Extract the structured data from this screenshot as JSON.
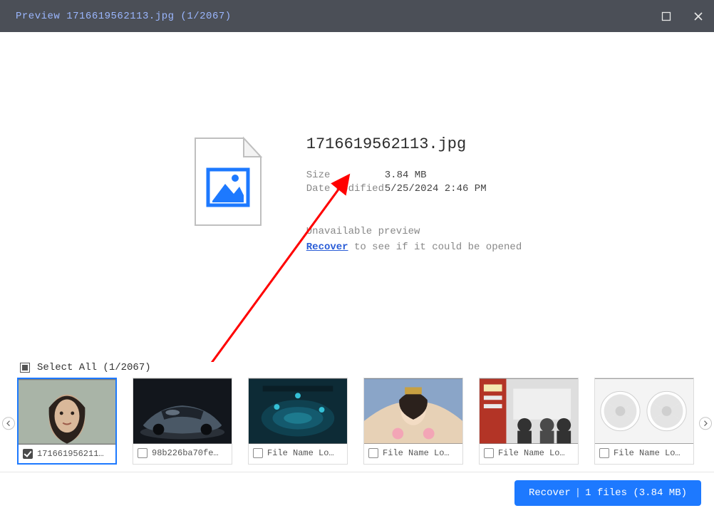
{
  "titlebar": {
    "title": "Preview 1716619562113.jpg (1/2067)"
  },
  "preview": {
    "filename": "1716619562113.jpg",
    "size_label": "Size",
    "size_value": "3.84 MB",
    "modified_label": "Date Modified",
    "modified_value": "5/25/2024 2:46 PM",
    "unavailable": "Unavailable preview",
    "recover_link": "Recover",
    "recover_suffix": " to see if it could be opened"
  },
  "strip_header": {
    "select_all": "Select All (1/2067)"
  },
  "thumbnails": [
    {
      "label": "171661956211…",
      "checked": true,
      "selected": true,
      "variant": "portrait"
    },
    {
      "label": "98b226ba70fe…",
      "checked": false,
      "selected": false,
      "variant": "car"
    },
    {
      "label": "File Name Lo…",
      "checked": false,
      "selected": false,
      "variant": "game"
    },
    {
      "label": "File Name Lo…",
      "checked": false,
      "selected": false,
      "variant": "costume"
    },
    {
      "label": "File Name Lo…",
      "checked": false,
      "selected": false,
      "variant": "meeting"
    },
    {
      "label": "File Name Lo…",
      "checked": false,
      "selected": false,
      "variant": "fans"
    }
  ],
  "footer": {
    "recover_label": "Recover",
    "recover_summary": "1 files (3.84 MB)"
  }
}
